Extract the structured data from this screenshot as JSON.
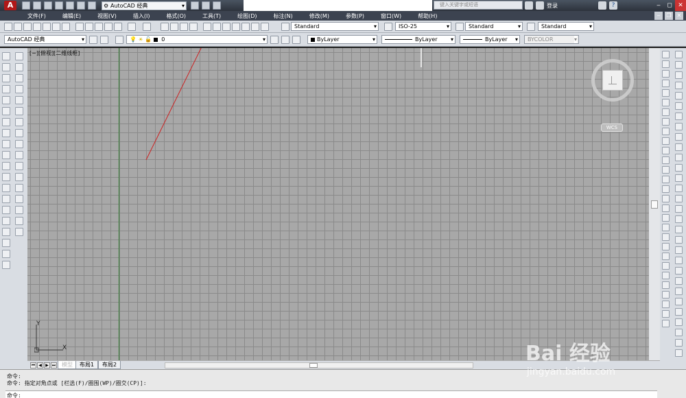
{
  "titlebar": {
    "workspace": "AutoCAD 经典",
    "search_placeholder": "键入关键字或短语",
    "login": "登录",
    "help": "?"
  },
  "menu": [
    "文件(F)",
    "编辑(E)",
    "视图(V)",
    "插入(I)",
    "格式(O)",
    "工具(T)",
    "绘图(D)",
    "标注(N)",
    "修改(M)",
    "参数(P)",
    "窗口(W)",
    "帮助(H)"
  ],
  "toolbar1": {
    "text_style": "Standard",
    "dim_style": "ISO-25",
    "table_style": "Standard",
    "multileader_style": "Standard"
  },
  "toolbar2": {
    "workspace": "AutoCAD 经典",
    "layer": "0",
    "color": "ByLayer",
    "linetype": "ByLayer",
    "lineweight": "ByLayer",
    "plotstyle": "BYCOLOR"
  },
  "canvas": {
    "view_label": "[−][俯视][二维线框]",
    "ucs_x": "X",
    "ucs_y": "Y",
    "wcs": "WCS"
  },
  "tabs": [
    "模型",
    "布局1",
    "布局2"
  ],
  "command": {
    "line1": "命令:",
    "line2": "命令: 指定对角点或 [栏选(F)/圈围(WP)/圈交(CP)]:",
    "prompt": "命令:"
  },
  "watermark": {
    "logo": "Bai 经验",
    "url": "jingyan.baidu.com"
  },
  "colors": {
    "canvas_bg": "#a8a8a8",
    "grid": "#8a8a8a",
    "y_axis": "#2f7a2f",
    "rubber_line": "#cc2222",
    "menubar": "#3c4350"
  }
}
